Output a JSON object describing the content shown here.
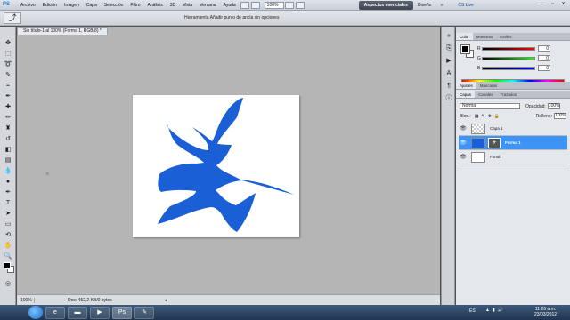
{
  "app": {
    "logo": "PS",
    "menu": [
      "Archivo",
      "Edición",
      "Imagen",
      "Capa",
      "Selección",
      "Filtro",
      "Análisis",
      "3D",
      "Vista",
      "Ventana",
      "Ayuda"
    ],
    "zoom_level": "100%",
    "workspace_active": "Aspectos esenciales",
    "workspace_other": "Diseño",
    "cs_live": "CS Live"
  },
  "options_bar": {
    "hint": "Herramienta Añadir punto de ancla sin opciones"
  },
  "document": {
    "tab_title": "Sin título-1 al 100% (Forma 1, RGB/8) *",
    "status_zoom": "100%",
    "status_doc": "Doc: 452,2 KB/0 bytes",
    "shape_color": "#1a5fd6"
  },
  "color_panel": {
    "tabs": [
      "Color",
      "Muestras",
      "Estilos"
    ],
    "rows": [
      {
        "label": "R",
        "value": "0"
      },
      {
        "label": "G",
        "value": "0"
      },
      {
        "label": "B",
        "value": "0"
      }
    ]
  },
  "adjust_panel": {
    "tabs": [
      "Ajustes",
      "Máscaras"
    ]
  },
  "layers_panel": {
    "tabs": [
      "Capas",
      "Canales",
      "Trazados"
    ],
    "blend_mode": "Normal",
    "opacity_label": "Opacidad:",
    "opacity_value": "100%",
    "lock_label": "Bloq.:",
    "fill_label": "Relleno:",
    "fill_value": "100%",
    "layers": [
      {
        "name": "Capa 1"
      },
      {
        "name": "Forma 1"
      },
      {
        "name": "Fondo"
      }
    ]
  },
  "taskbar": {
    "lang": "ES",
    "time": "11:26 a.m.",
    "date": "23/03/2012"
  }
}
